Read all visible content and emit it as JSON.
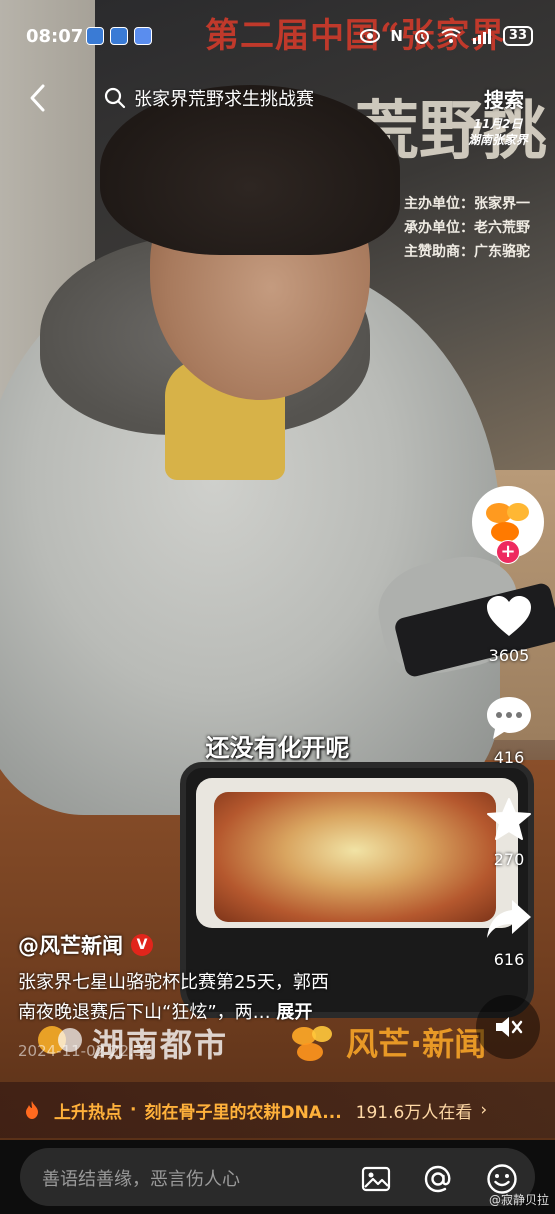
{
  "status_bar": {
    "time": "08:07",
    "battery": "33"
  },
  "search": {
    "query": "张家界荒野求生挑战赛",
    "submit_label": "搜索"
  },
  "background_banner": {
    "title": "第二届中国“张家界",
    "big_text": "荒野挑",
    "date_line1": "11月2日",
    "date_line2": "湖南张家界",
    "organizer": "主办单位：张家界一",
    "co_organizer": "承办单位：老六荒野",
    "sponsor": "主赞助商：广东骆驼"
  },
  "video": {
    "caption": "还没有化开呢",
    "watermark_hunan": "湖南都市",
    "watermark_mango": "风芒·新闻"
  },
  "rail": {
    "like_count": "3605",
    "comment_count": "416",
    "favorite_count": "270",
    "share_count": "616"
  },
  "post": {
    "author": "@风芒新闻",
    "verified_badge": "V",
    "description_line1": "张家界七星山骆驼杯比赛第25天，郭西",
    "description_line2": "南夜晚退赛后下山“狂炫”，两…",
    "expand_label": "展开",
    "timestamp": "2024-11-02 22:35"
  },
  "hot_topic": {
    "label": "上升热点",
    "separator": "·",
    "topic": "刻在骨子里的农耕DNA...",
    "views": "191.6万人在看",
    "arrow": "›"
  },
  "comment_bar": {
    "placeholder": "善语结善缘，恶言伤人心",
    "weibo_watermark": "@寂静贝拉"
  },
  "colors": {
    "hot_accent": "#ffb13b",
    "follow_plus": "#ee2a5f",
    "verified": "#e1251b",
    "comment_box": "#2a2a2a"
  }
}
